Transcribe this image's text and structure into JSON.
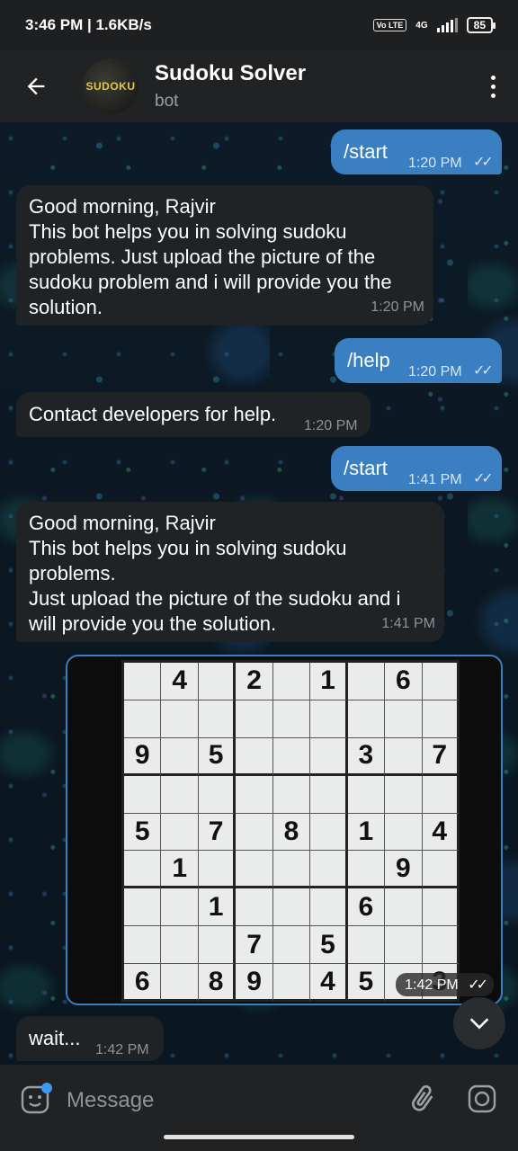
{
  "status": {
    "time_speed": "3:46 PM | 1.6KB/s",
    "volte": "Vo LTE",
    "network": "4G",
    "battery": "85"
  },
  "header": {
    "avatar_text": "SUDOKU",
    "title": "Sudoku Solver",
    "subtitle": "bot"
  },
  "messages": [
    {
      "text": "/start",
      "time": "1:20 PM"
    },
    {
      "lines": [
        "Good morning, Rajvir",
        "This bot helps you in solving sudoku",
        "problems. Just upload the picture of the",
        "sudoku problem and i will provide you the",
        "solution."
      ],
      "time": "1:20 PM"
    },
    {
      "text": "/help",
      "time": "1:20 PM"
    },
    {
      "text": "Contact developers for help.",
      "time": "1:20 PM"
    },
    {
      "text": "/start",
      "time": "1:41 PM"
    },
    {
      "lines": [
        "Good morning, Rajvir",
        "This bot helps you in solving sudoku",
        "problems.",
        "Just upload the picture of the sudoku and i",
        "will provide you the solution."
      ],
      "time": "1:41 PM"
    },
    {
      "photo_time": "1:42 PM"
    },
    {
      "text": "wait...",
      "time": "1:42 PM"
    }
  ],
  "sudoku": [
    [
      "",
      "4",
      "",
      "2",
      "",
      "1",
      "",
      "6",
      ""
    ],
    [
      "",
      "",
      "",
      "",
      "",
      "",
      "",
      "",
      ""
    ],
    [
      "9",
      "",
      "5",
      "",
      "",
      "",
      "3",
      "",
      "7"
    ],
    [
      "",
      "",
      "",
      "",
      "",
      "",
      "",
      "",
      ""
    ],
    [
      "5",
      "",
      "7",
      "",
      "8",
      "",
      "1",
      "",
      "4"
    ],
    [
      "",
      "1",
      "",
      "",
      "",
      "",
      "",
      "9",
      ""
    ],
    [
      "",
      "",
      "1",
      "",
      "",
      "",
      "6",
      "",
      ""
    ],
    [
      "",
      "",
      "",
      "7",
      "",
      "5",
      "",
      "",
      ""
    ],
    [
      "6",
      "",
      "8",
      "9",
      "",
      "4",
      "5",
      "",
      "3"
    ]
  ],
  "input": {
    "placeholder": "Message"
  },
  "icons": {
    "back": "arrow-back-icon",
    "menu": "more-vert-icon",
    "emoji": "sticker-emoji-icon",
    "attach": "paperclip-icon",
    "camera": "camera-icon",
    "scroll": "chevron-down-icon",
    "read": "double-check-icon"
  }
}
